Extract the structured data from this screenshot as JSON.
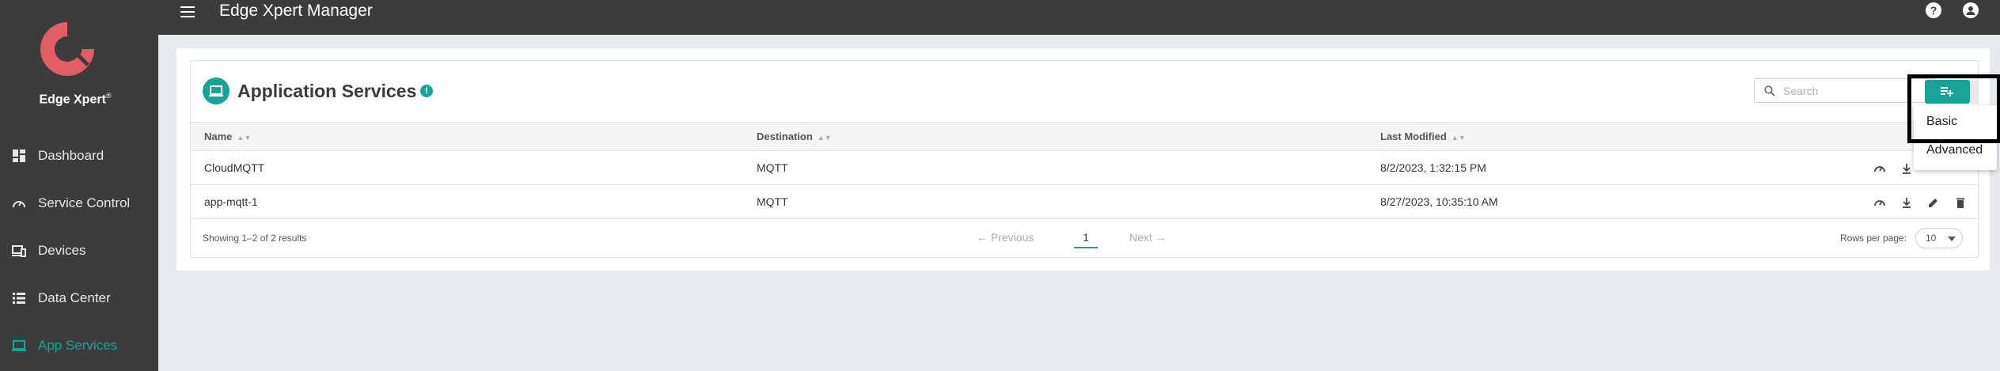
{
  "app": {
    "title": "Edge Xpert Manager"
  },
  "brand": {
    "name": "Edge Xpert",
    "reg": "®",
    "accent": "#17a398",
    "logo_color": "#e35d64"
  },
  "sidebar": {
    "items": [
      {
        "label": "Dashboard",
        "icon": "dashboard-icon",
        "active": false
      },
      {
        "label": "Service Control",
        "icon": "speedometer-icon",
        "active": false
      },
      {
        "label": "Devices",
        "icon": "devices-icon",
        "active": false
      },
      {
        "label": "Data Center",
        "icon": "list-icon",
        "active": false
      },
      {
        "label": "App Services",
        "icon": "monitor-icon",
        "active": true
      }
    ]
  },
  "topbar": {
    "help_icon": "help-icon",
    "account_icon": "account-icon",
    "help_glyph": "?",
    "account_glyph": "●"
  },
  "page": {
    "title": "Application Services",
    "info_glyph": "!",
    "search_placeholder": "Search",
    "add_icon": "playlist-add-icon"
  },
  "table": {
    "columns": [
      "Name",
      "Destination",
      "Last Modified"
    ],
    "rows": [
      {
        "name": "CloudMQTT",
        "destination": "MQTT",
        "last_modified": "8/2/2023, 1:32:15 PM"
      },
      {
        "name": "app-mqtt-1",
        "destination": "MQTT",
        "last_modified": "8/27/2023, 10:35:10 AM"
      }
    ]
  },
  "footer": {
    "showing": "Showing 1–2 of 2 results",
    "previous": "← Previous",
    "page": "1",
    "next": "Next →",
    "rows_per_page_label": "Rows per page:",
    "rows_per_page_value": "10"
  },
  "dropdown": {
    "items": [
      "Basic",
      "Advanced"
    ]
  }
}
